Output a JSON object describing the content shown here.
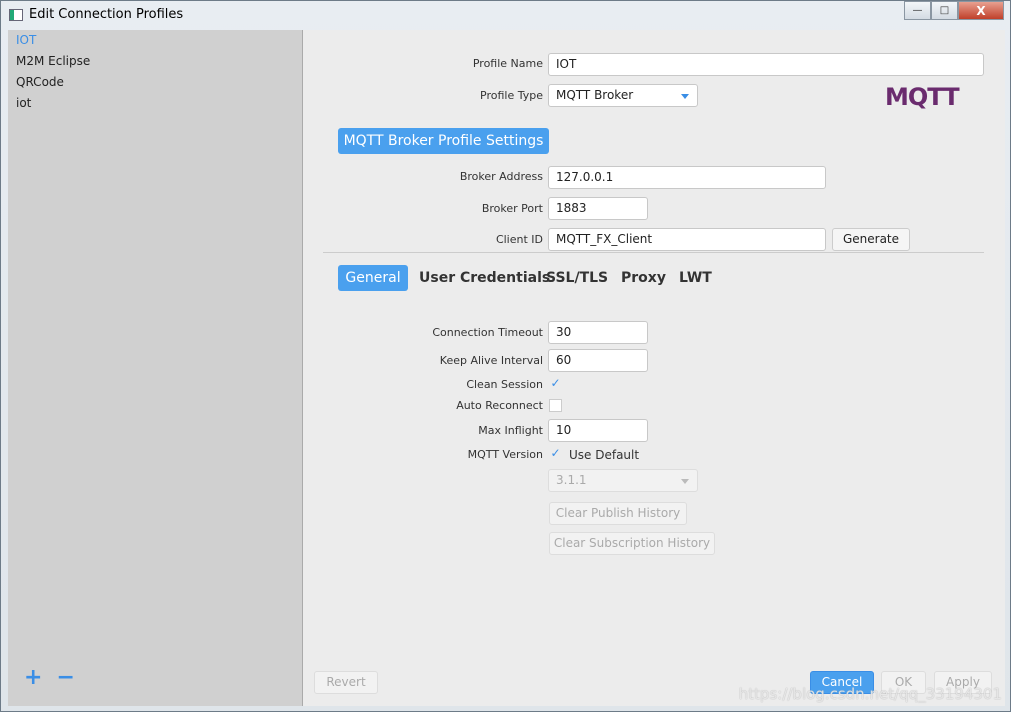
{
  "window": {
    "title": "Edit Connection Profiles",
    "minimize": "—",
    "maximize": "□",
    "close": "X"
  },
  "sidebar": {
    "items": [
      {
        "label": "IOT",
        "selected": true
      },
      {
        "label": "M2M Eclipse"
      },
      {
        "label": "QRCode"
      },
      {
        "label": "iot"
      }
    ],
    "add": "+",
    "remove": "−"
  },
  "profile": {
    "name_label": "Profile Name",
    "name_value": "IOT",
    "type_label": "Profile Type",
    "type_value": "MQTT Broker",
    "logo": "MQTT.ORG"
  },
  "broker": {
    "section": "MQTT Broker Profile Settings",
    "address_label": "Broker Address",
    "address_value": "127.0.0.1",
    "port_label": "Broker Port",
    "port_value": "1883",
    "client_label": "Client ID",
    "client_value": "MQTT_FX_Client",
    "generate": "Generate"
  },
  "tabs": [
    {
      "label": "General",
      "active": true
    },
    {
      "label": "User Credentials"
    },
    {
      "label": "SSL/TLS"
    },
    {
      "label": "Proxy"
    },
    {
      "label": "LWT"
    }
  ],
  "general": {
    "timeout_label": "Connection Timeout",
    "timeout_value": "30",
    "keepalive_label": "Keep Alive Interval",
    "keepalive_value": "60",
    "clean_label": "Clean Session",
    "clean_checked": true,
    "auto_label": "Auto Reconnect",
    "auto_checked": false,
    "inflight_label": "Max Inflight",
    "inflight_value": "10",
    "version_label": "MQTT Version",
    "use_default_label": "Use Default",
    "use_default_checked": true,
    "version_value": "3.1.1",
    "clear_publish": "Clear Publish History",
    "clear_subscription": "Clear Subscription History"
  },
  "footer": {
    "revert": "Revert",
    "cancel": "Cancel",
    "ok": "OK",
    "apply": "Apply"
  },
  "watermark": "https://blog.csdn.net/qq_33194301",
  "colors": {
    "accent": "#4aa0ee"
  }
}
